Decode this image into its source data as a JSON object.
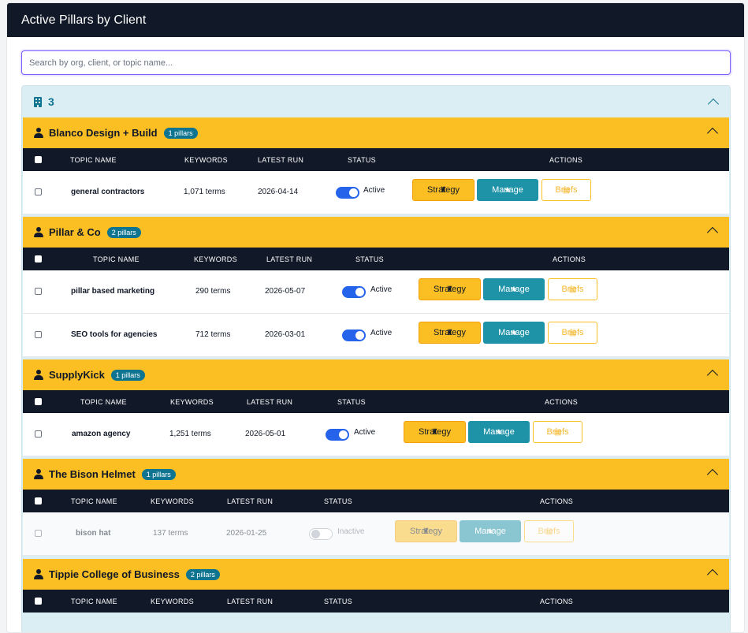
{
  "header": {
    "title": "Active Pillars by Client"
  },
  "search": {
    "placeholder": "Search by org, client, or topic name..."
  },
  "org": {
    "count": "3"
  },
  "columns": {
    "topic": "TOPIC NAME",
    "keywords": "KEYWORDS",
    "latest_run": "LATEST RUN",
    "status": "STATUS",
    "actions": "ACTIONS"
  },
  "actions": {
    "strategy": "Strategy",
    "manage": "Manage",
    "briefs": "Briefs"
  },
  "clients": [
    {
      "name": "Blanco Design + Build",
      "badge": "1 pillars",
      "rows": [
        {
          "topic": "general contractors",
          "keywords": "1,071 terms",
          "run": "2026-04-14",
          "status": "Active",
          "active": true
        }
      ]
    },
    {
      "name": "Pillar & Co",
      "badge": "2 pillars",
      "rows": [
        {
          "topic": "pillar based marketing",
          "keywords": "290 terms",
          "run": "2026-05-07",
          "status": "Active",
          "active": true
        },
        {
          "topic": "SEO tools for agencies",
          "keywords": "712 terms",
          "run": "2026-03-01",
          "status": "Active",
          "active": true
        }
      ]
    },
    {
      "name": "SupplyKick",
      "badge": "1 pillars",
      "rows": [
        {
          "topic": "amazon agency",
          "keywords": "1,251 terms",
          "run": "2026-05-01",
          "status": "Active",
          "active": true
        }
      ]
    },
    {
      "name": "The Bison Helmet",
      "badge": "1 pillars",
      "rows": [
        {
          "topic": "bison hat",
          "keywords": "137 terms",
          "run": "2026-01-25",
          "status": "Inactive",
          "active": false
        }
      ]
    },
    {
      "name": "Tippie College of Business",
      "badge": "2 pillars",
      "rows": []
    }
  ]
}
